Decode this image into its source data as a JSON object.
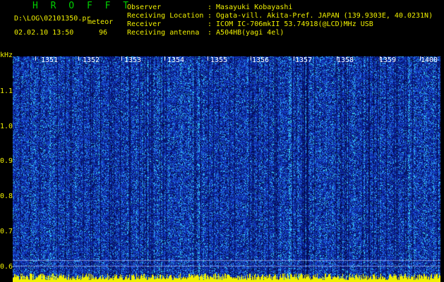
{
  "header": {
    "app_title": "H R O F F T",
    "file_path": "D:\\LOG\\02101350.pr",
    "mode": "meteor",
    "datetime": "02.02.10 13:50",
    "count": "96"
  },
  "info": {
    "labels": [
      "Observer",
      "Receiving Location",
      "Receiver",
      "Receiving antenna"
    ],
    "values": [
      ": Masayuki Kobayashi",
      ": Ogata-vill. Akita-Pref. JAPAN (139.9303E, 40.0231N)",
      ": ICOM IC-706mkII 53.74918(@LCD)MHz USB",
      ": A504HB(yagi 4el)"
    ]
  },
  "axis": {
    "unit": "kHz",
    "y_ticks": [
      "1.1",
      "1.0",
      "0.9",
      "0.8",
      "0.7",
      "0.6"
    ],
    "minutes": [
      "1351",
      "1352",
      "1353",
      "1354",
      "1355",
      "1356",
      "1357",
      "1358",
      "1359",
      "1400"
    ]
  },
  "colors": {
    "background": "#000000",
    "spectrum_low": "#0a1f8a",
    "spectrum_mid": "#1e4fe0",
    "spectrum_high": "#30d0ff",
    "baseline": "#f0f000",
    "text": "#f0f000",
    "title": "#00d000"
  }
}
